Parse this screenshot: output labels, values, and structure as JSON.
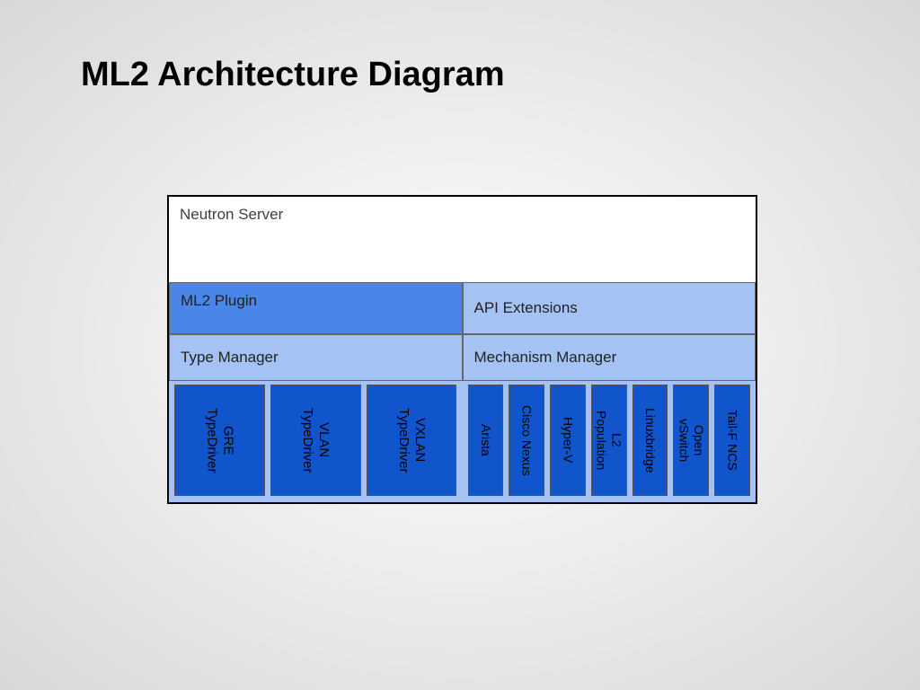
{
  "title": "ML2 Architecture Diagram",
  "neutron": "Neutron Server",
  "ml2_plugin": "ML2 Plugin",
  "api_ext": "API Extensions",
  "type_mgr": "Type Manager",
  "mech_mgr": "Mechanism Manager",
  "type_drivers": [
    "GRE\nTypeDriver",
    "VLAN\nTypeDriver",
    "VXLAN\nTypeDriver"
  ],
  "mech_drivers": [
    "Arista",
    "Cisco Nexus",
    "Hyper-V",
    "L2\nPopulation",
    "Linuxbridge",
    "Open\nvSwitch",
    "Tail-F NCS"
  ]
}
